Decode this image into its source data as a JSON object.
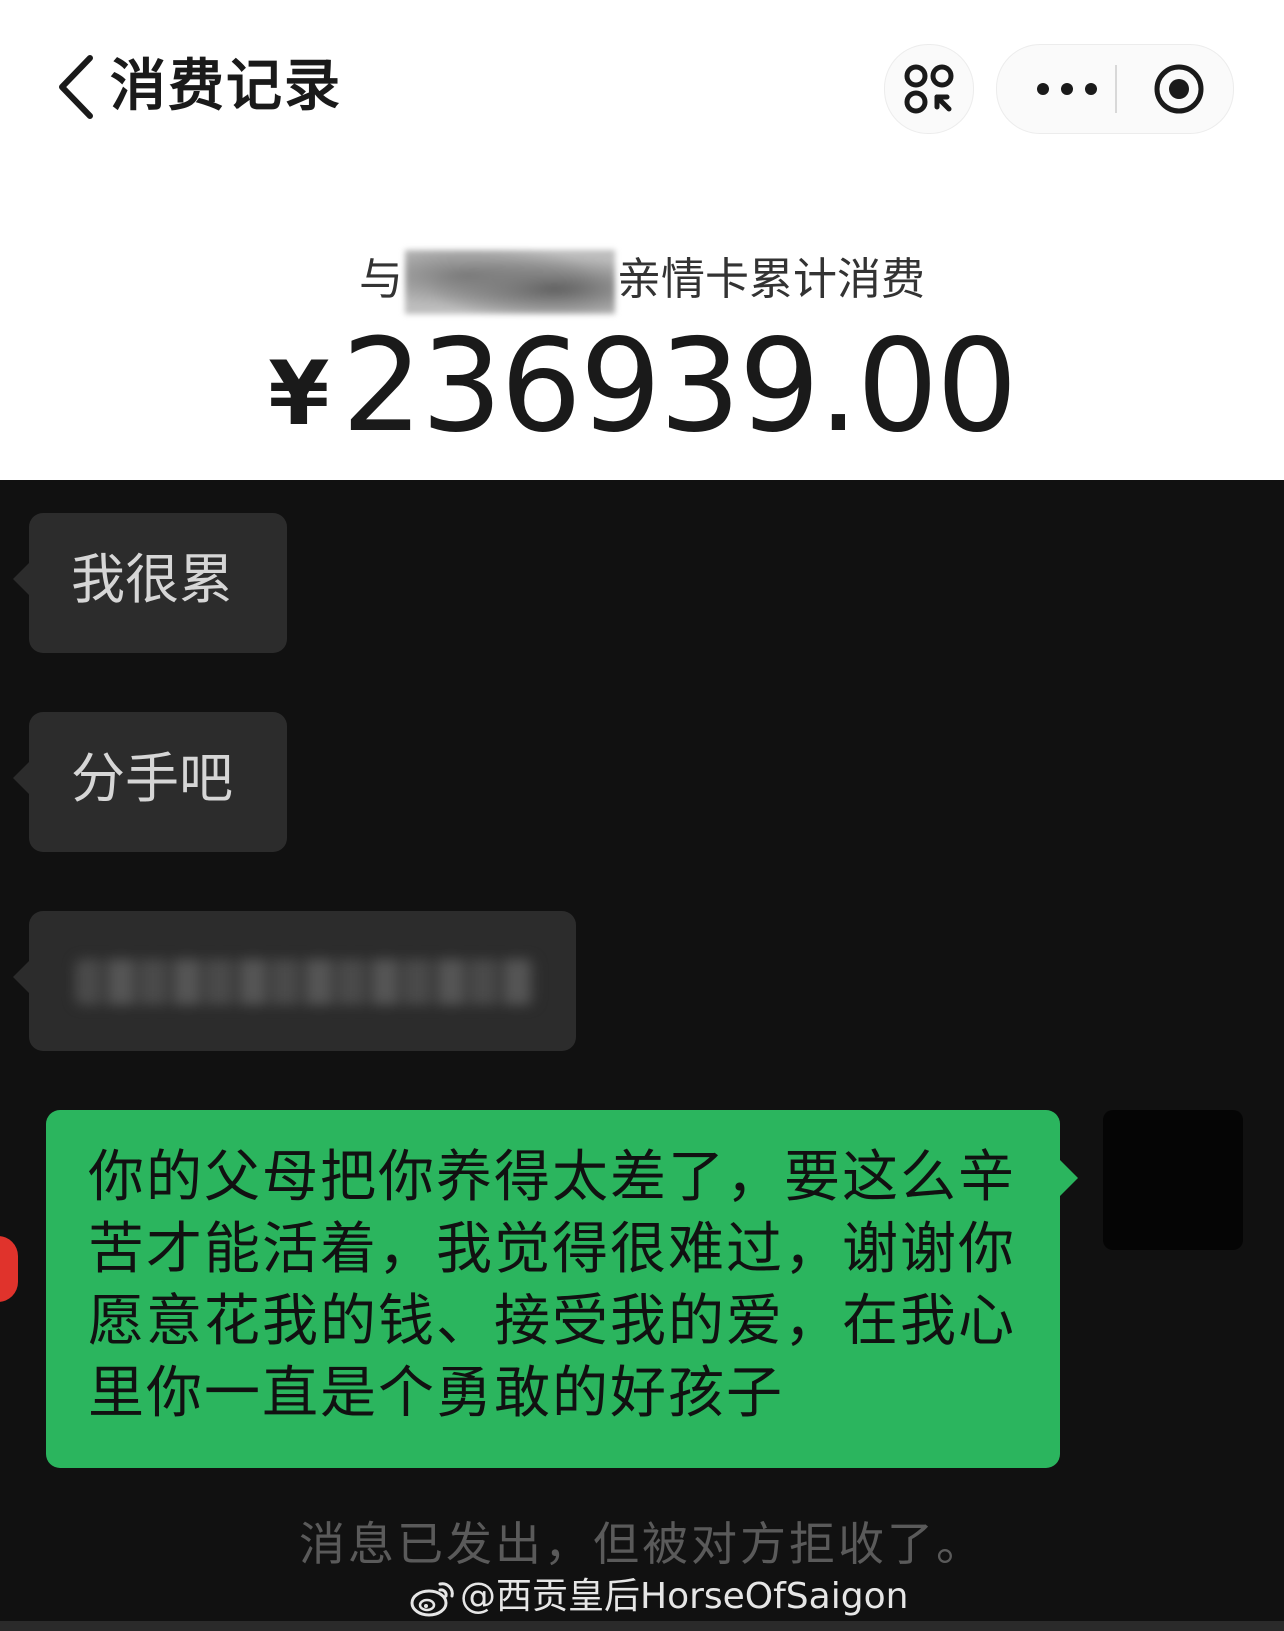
{
  "header": {
    "title": "消费记录",
    "back_icon": "chevron-left-icon",
    "scan_icon": "scan-qr-icon",
    "more_icon": "more-dots-icon",
    "close_icon": "target-close-icon"
  },
  "summary": {
    "label_prefix": "与",
    "label_suffix": "亲情卡累计消费",
    "currency": "¥",
    "amount": "236939.00"
  },
  "chat": {
    "incoming": [
      {
        "text": "我很累"
      },
      {
        "text": "分手吧"
      },
      {
        "text": ""
      }
    ],
    "outgoing": {
      "text": "你的父母把你养得太差了，要这么辛苦才能活着，我觉得很难过，谢谢你愿意花我的钱、接受我的爱，在我心里你一直是个勇敢的好孩子"
    },
    "status": "消息已发出，但被对方拒收了。"
  },
  "watermark": {
    "text": "@西贡皇后HorseOfSaigon",
    "icon": "weibo-icon"
  },
  "colors": {
    "outgoing_bubble": "#2bb55e",
    "incoming_bubble": "#2c2c2c",
    "chat_background": "#111111",
    "unread_dot": "#e0332c"
  }
}
